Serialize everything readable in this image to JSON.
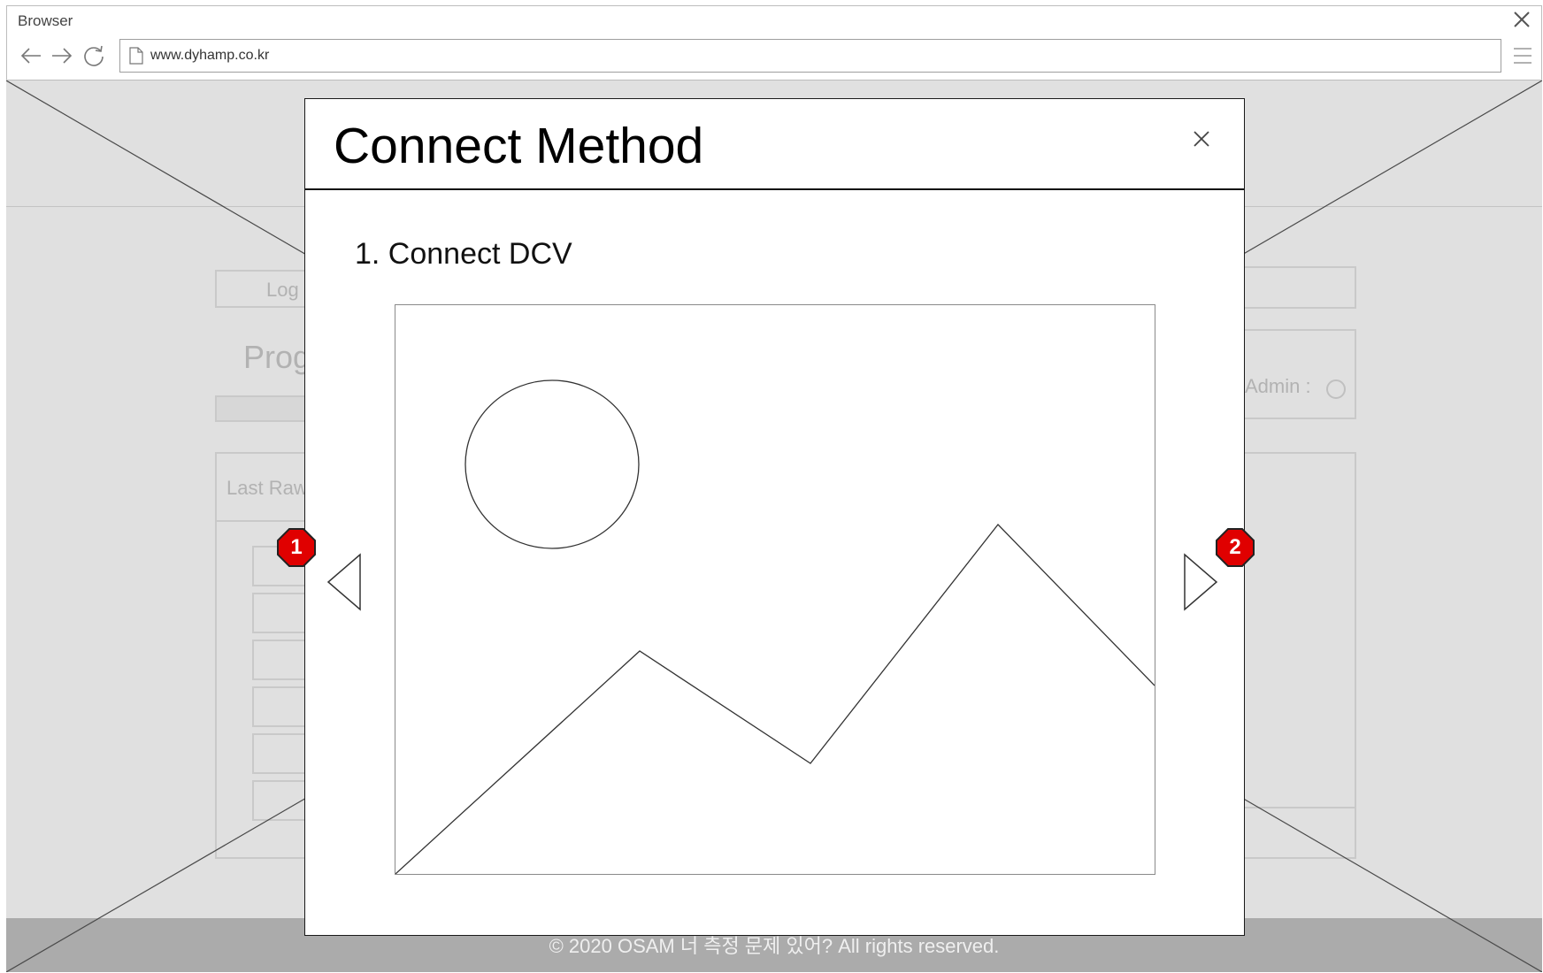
{
  "browser": {
    "title": "Browser",
    "url": "www.dyhamp.co.kr"
  },
  "background": {
    "log_button": "Log",
    "progress_label": "Prog",
    "admin_label": "Admin :",
    "last_raw_label": "Last Raw",
    "footer_text": "© 2020 OSAM 너 측정 문제 있어? All rights reserved."
  },
  "modal": {
    "title": "Connect Method",
    "step_title": "1. Connect DCV"
  },
  "annotations": [
    {
      "label": "1",
      "color": "#e00000"
    },
    {
      "label": "2",
      "color": "#e00000"
    }
  ]
}
